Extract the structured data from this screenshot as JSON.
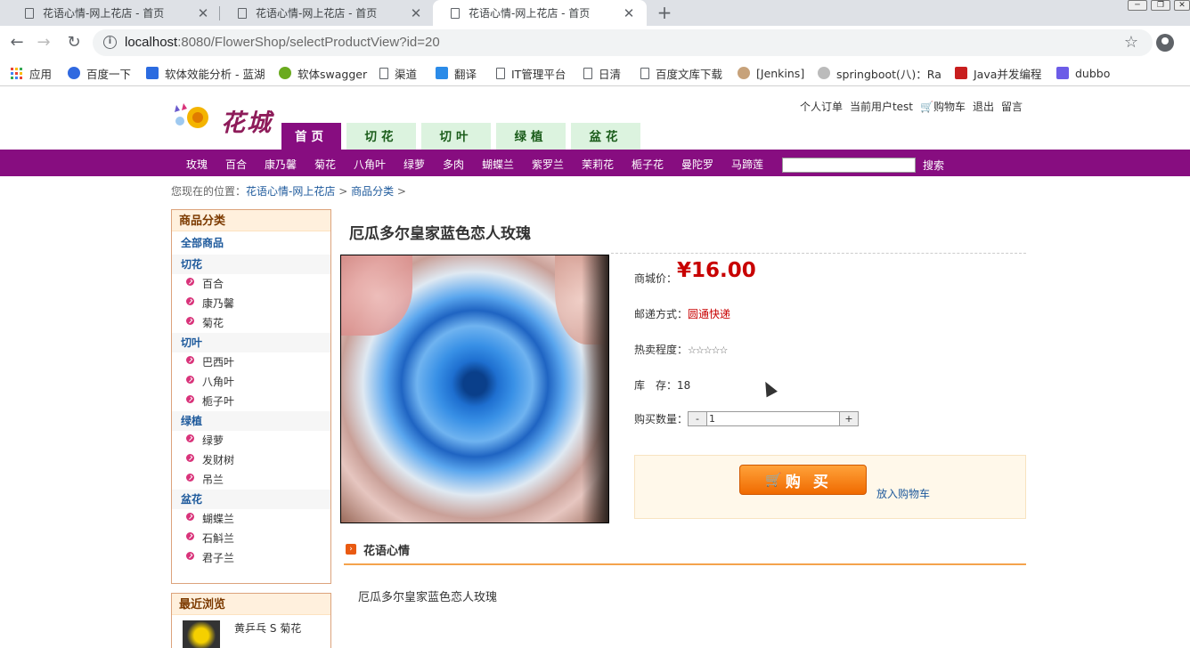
{
  "browser": {
    "tabs": [
      {
        "title": "花语心情-网上花店 - 首页"
      },
      {
        "title": "花语心情-网上花店 - 首页"
      },
      {
        "title": "花语心情-网上花店 - 首页"
      }
    ],
    "url_host": "localhost",
    "url_rest": ":8080/FlowerShop/selectProductView?id=20",
    "bookmarks": [
      "应用",
      "百度一下",
      "软体效能分析 - 蓝湖",
      "软体swagger",
      "渠道",
      "翻译",
      "IT管理平台",
      "日清",
      "百度文库下载",
      "[Jenkins]",
      "springboot(八)：Ra",
      "Java并发编程",
      "dubbo"
    ]
  },
  "site": {
    "logo_text": "花城",
    "top_links": [
      "个人订单",
      "当前用户test",
      "购物车",
      "退出",
      "留言"
    ],
    "main_tabs": [
      "首页",
      "切花",
      "切叶",
      "绿植",
      "盆花"
    ],
    "categories": [
      "玫瑰",
      "百合",
      "康乃馨",
      "菊花",
      "八角叶",
      "绿萝",
      "多肉",
      "蝴蝶兰",
      "紫罗兰",
      "茉莉花",
      "栀子花",
      "曼陀罗",
      "马蹄莲"
    ],
    "search_button": "搜索",
    "breadcrumb": {
      "prefix": "您现在的位置：",
      "home": "花语心情-网上花店",
      "sep": ">",
      "current": "商品分类",
      "tail": ">"
    }
  },
  "sidebar": {
    "title": "商品分类",
    "all": "全部商品",
    "groups": [
      {
        "name": "切花",
        "items": [
          "百合",
          "康乃馨",
          "菊花"
        ]
      },
      {
        "name": "切叶",
        "items": [
          "巴西叶",
          "八角叶",
          "栀子叶"
        ]
      },
      {
        "name": "绿植",
        "items": [
          "绿萝",
          "发财树",
          "吊兰"
        ]
      },
      {
        "name": "盆花",
        "items": [
          "蝴蝶兰",
          "石斛兰",
          "君子兰"
        ]
      }
    ],
    "recent_title": "最近浏览",
    "recent_item": "黄乒乓 S 菊花"
  },
  "product": {
    "name": "厄瓜多尔皇家蓝色恋人玫瑰",
    "price_label": "商城价：",
    "price": "¥16.00",
    "ship_label": "邮递方式：",
    "ship_value": "圆通快递",
    "hot_label": "热卖程度：",
    "hot_stars": "☆☆☆☆☆",
    "stock_label": "库　存：",
    "stock_value": "18",
    "qty_label": "购买数量：",
    "qty_minus": "-",
    "qty_value": "1",
    "qty_plus": "+",
    "buy_label": "购买",
    "add_cart": "放入购物车",
    "section_title": "花语心情",
    "description": "厄瓜多尔皇家蓝色恋人玫瑰"
  }
}
